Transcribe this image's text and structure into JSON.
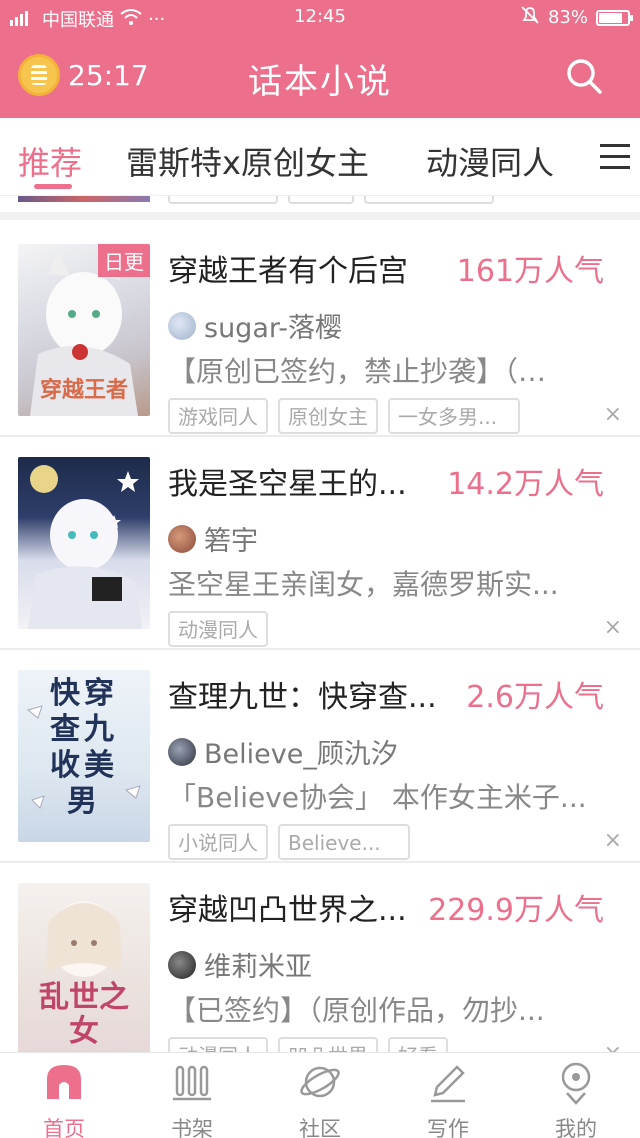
{
  "status_bar": {
    "carrier": "中国联通",
    "dots": "···",
    "time": "12:45",
    "battery": "83%",
    "battery_level": 0.83
  },
  "header": {
    "timer": "25:17",
    "title": "话本小说"
  },
  "tabs": [
    {
      "label": "推荐",
      "active": true
    },
    {
      "label": "雷斯特x原创女主",
      "active": false
    },
    {
      "label": "动漫同人",
      "active": false
    }
  ],
  "books": [
    {
      "title": "穿越王者有个后宫",
      "popularity": "161万人气",
      "badge": "日更",
      "author": "sugar-落樱",
      "description": "【原创已签约，禁止抄袭】（…",
      "tags": [
        "游戏同人",
        "原创女主",
        "一女多男..."
      ],
      "cover_text": "穿越王者",
      "close": "×"
    },
    {
      "title": "我是圣空星王的...",
      "popularity": "14.2万人气",
      "author": "箬宇",
      "description": "圣空星王亲闺女，嘉德罗斯实...",
      "tags": [
        "动漫同人"
      ],
      "close": "×"
    },
    {
      "title": "查理九世：快穿查...",
      "popularity": "2.6万人气",
      "author": "Believe_顾氿汐",
      "description": "「Believe协会」 本作女主米子...",
      "tags": [
        "小说同人",
        "Believe..."
      ],
      "cover_text": "快穿查九收美男",
      "close": "×"
    },
    {
      "title": "穿越凹凸世界之...",
      "popularity": "229.9万人气",
      "author": "维莉米亚",
      "description": "【已签约】（原创作品，勿抄...",
      "tags": [
        "动漫同人",
        "凹凸世界",
        "好看"
      ],
      "cover_text": "乱世之女",
      "close": "×"
    }
  ],
  "bottom_nav": [
    {
      "label": "首页",
      "icon": "home-icon",
      "active": true
    },
    {
      "label": "书架",
      "icon": "bookshelf-icon",
      "active": false
    },
    {
      "label": "社区",
      "icon": "planet-icon",
      "active": false
    },
    {
      "label": "写作",
      "icon": "pen-icon",
      "active": false
    },
    {
      "label": "我的",
      "icon": "profile-icon",
      "active": false
    }
  ],
  "colors": {
    "accent": "#ec6f8c",
    "popularity": "#ec6f8c",
    "muted_text": "#888888"
  }
}
